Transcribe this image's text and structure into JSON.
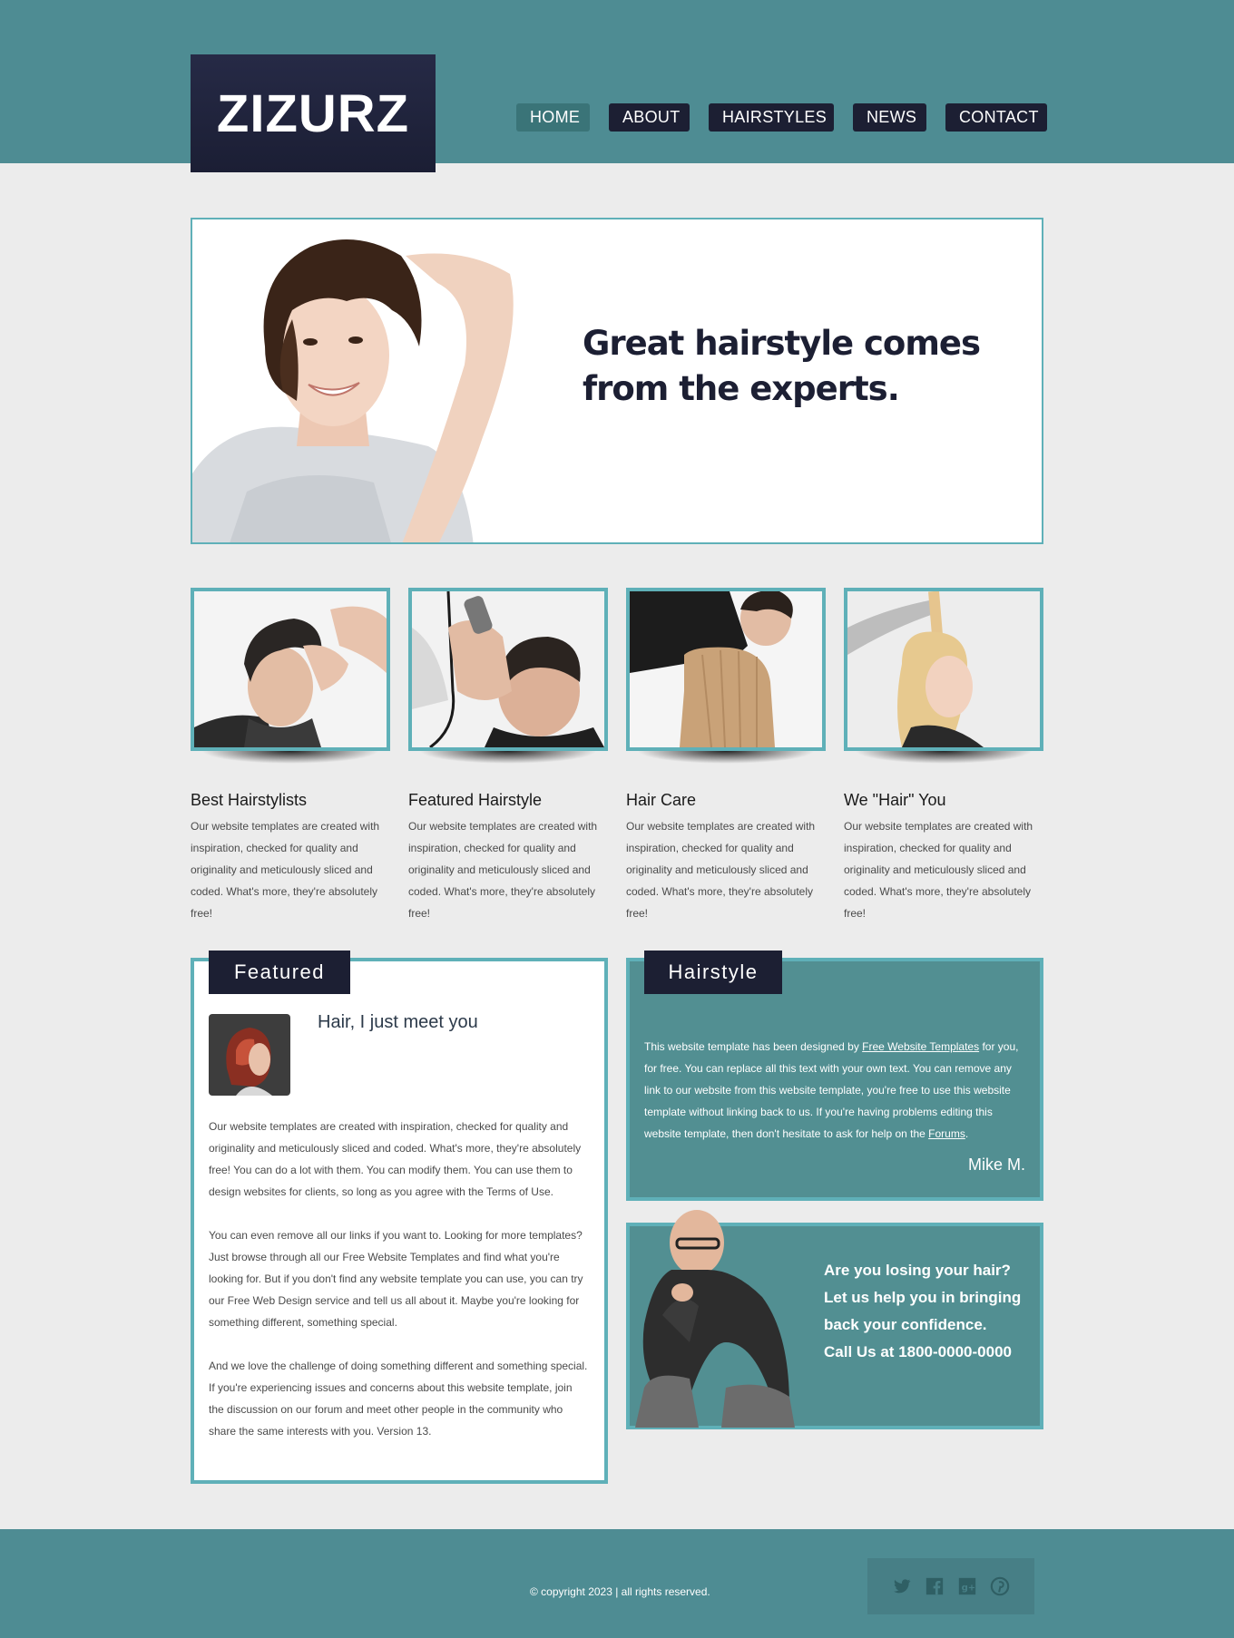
{
  "header": {
    "logo": "ZIZURZ",
    "nav": [
      "HOME",
      "ABOUT",
      "HAIRSTYLES",
      "NEWS",
      "CONTACT"
    ],
    "active_nav": "HOME"
  },
  "hero": {
    "headline_line1": "Great hairstyle comes",
    "headline_line2": "from the experts."
  },
  "features": [
    {
      "title": "Best Hairstylists",
      "text": "Our website templates are created with inspiration, checked for quality and originality and meticulously sliced and coded. What's more, they're absolutely free!"
    },
    {
      "title": "Featured Hairstyle",
      "text": "Our website templates are created with inspiration, checked for quality and originality and meticulously sliced and coded. What's more, they're absolutely free!"
    },
    {
      "title": "Hair Care",
      "text": "Our website templates are created with inspiration, checked for quality and originality and meticulously sliced and coded. What's more, they're absolutely free!"
    },
    {
      "title": "We \"Hair\" You",
      "text": "Our website templates are created with inspiration, checked for quality and originality and meticulously sliced and coded. What's more, they're absolutely free!"
    }
  ],
  "featured": {
    "tab": "Featured",
    "title": "Hair, I just meet you",
    "paragraphs": [
      "Our website templates are created with inspiration, checked for quality and originality and meticulously sliced and coded. What's more, they're absolutely free! You can do a lot with them. You can modify them. You can use them to design websites for clients, so long as you agree with the Terms of Use.",
      "You can even remove all our links if you want to. Looking for more templates? Just browse through all our Free Website Templates and find what you're looking for. But if you don't find any website template you can use, you can try our Free Web Design service and tell us all about it. Maybe you're looking for something different, something special.",
      "And we love the challenge of doing something different and something special. If you're experiencing issues and concerns about this website template, join the discussion on our forum and meet other people in the community who share the same interests with you. Version 13."
    ]
  },
  "hairstyle": {
    "tab": "Hairstyle",
    "text_a": "This website template has been designed by ",
    "link_templates": "Free Website Templates",
    "text_b": " for you, for free. You can replace all this text with your own text. You can remove any link to our website from this website template, you're free to use this website template without linking back to us. If you're having problems editing this website template, then don't hesitate to ask for help on the ",
    "link_forums": "Forums",
    "text_c": ".",
    "signature": "Mike M."
  },
  "promo": {
    "line1": "Are you losing your hair?",
    "line2": "Let us help you in bringing",
    "line3": "back your confidence.",
    "line4": "Call Us at 1800-0000-0000"
  },
  "footer": {
    "copyright": "© copyright 2023 | all rights reserved.",
    "social_icons": [
      "twitter-icon",
      "facebook-icon",
      "googleplus-icon",
      "pinterest-icon"
    ]
  },
  "colors": {
    "teal": "#4e8c93",
    "teal_border": "#5fb0b8",
    "navy": "#1c1f33",
    "background": "#ececec"
  }
}
